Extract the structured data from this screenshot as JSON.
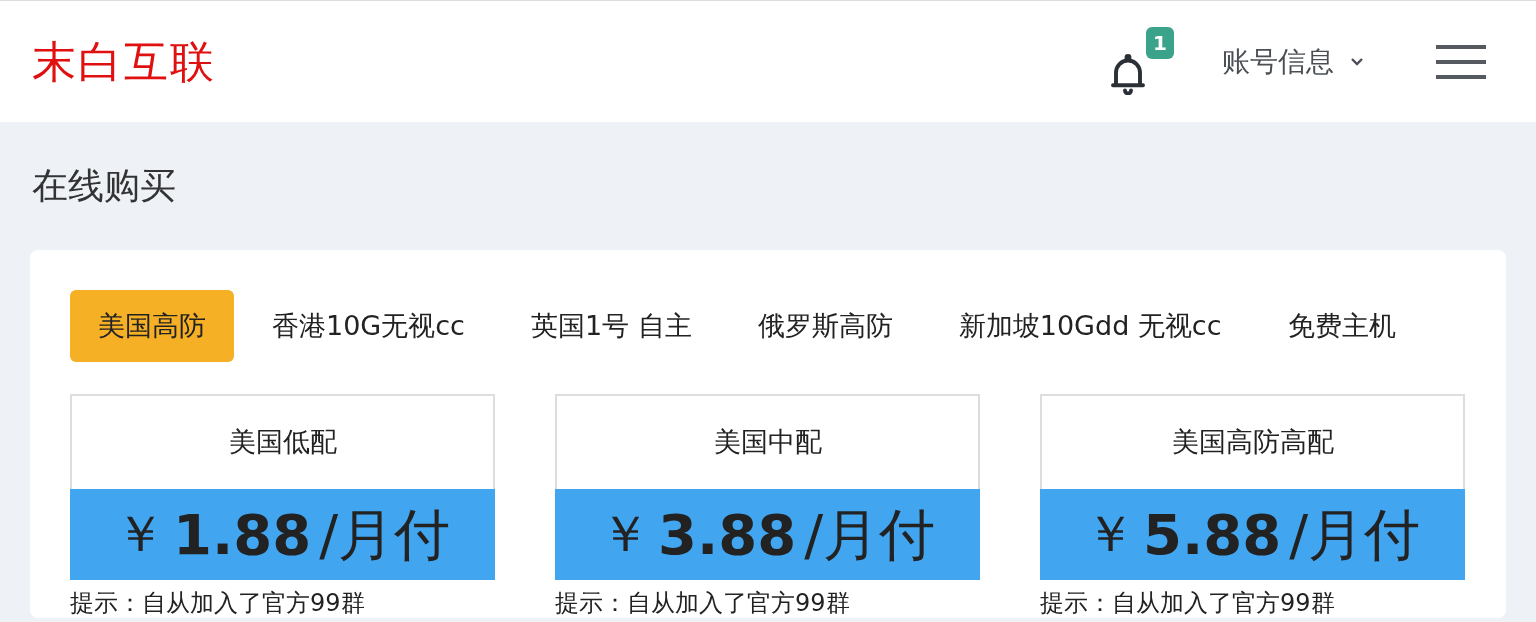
{
  "header": {
    "logo": "末白互联",
    "notifications": {
      "count": "1"
    },
    "account_menu": {
      "label": "账号信息"
    }
  },
  "page_title": "在线购买",
  "tabs": [
    {
      "label": "美国高防",
      "selected": true
    },
    {
      "label": "香港10G无视cc",
      "selected": false
    },
    {
      "label": "英国1号 自主",
      "selected": false
    },
    {
      "label": "俄罗斯高防",
      "selected": false
    },
    {
      "label": "新加坡10Gdd 无视cc",
      "selected": false
    },
    {
      "label": "免费主机",
      "selected": false
    }
  ],
  "plans": [
    {
      "name": "美国低配",
      "currency": "￥",
      "price": "1.88",
      "period": "/月付",
      "note": "提示：自从加入了官方99群"
    },
    {
      "name": "美国中配",
      "currency": "￥",
      "price": "3.88",
      "period": "/月付",
      "note": "提示：自从加入了官方99群"
    },
    {
      "name": "美国高防高配",
      "currency": "￥",
      "price": "5.88",
      "period": "/月付",
      "note": "提示：自从加入了官方99群"
    }
  ]
}
